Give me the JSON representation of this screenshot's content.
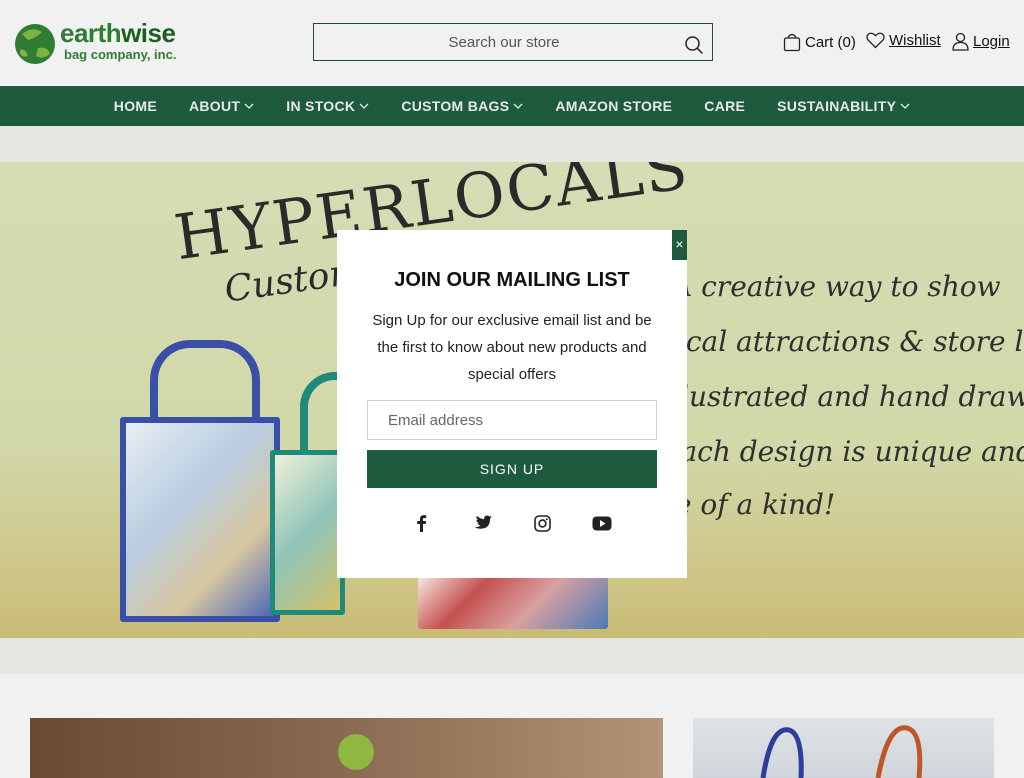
{
  "header": {
    "logo": {
      "main_a": "earth",
      "main_b": "wise",
      "sub": "bag company, inc."
    },
    "search": {
      "placeholder": "Search our store"
    },
    "cart": {
      "label": "Cart (",
      "count": "0",
      "close": ")"
    },
    "wishlist_label": " Wishlist",
    "login_label": " Login"
  },
  "nav": {
    "items": [
      {
        "label": "HOME",
        "has_dropdown": false
      },
      {
        "label": "ABOUT",
        "has_dropdown": true
      },
      {
        "label": "IN STOCK",
        "has_dropdown": true
      },
      {
        "label": "CUSTOM BAGS",
        "has_dropdown": true
      },
      {
        "label": "AMAZON STORE",
        "has_dropdown": false
      },
      {
        "label": "CARE",
        "has_dropdown": false
      },
      {
        "label": "SUSTAINABILITY",
        "has_dropdown": true
      }
    ]
  },
  "hero": {
    "title": "HYPERLOCALS",
    "subtitle": "Customized",
    "lines": [
      "A creative way to show",
      "local attractions & store locations.",
      "Illustrated and hand drawn",
      "Each design is unique and",
      "one of a kind!"
    ]
  },
  "modal": {
    "close_label": "×",
    "title": "JOIN OUR MAILING LIST",
    "text": "Sign Up for our exclusive email list and be the first to know about new products and special offers",
    "email_placeholder": "Email address",
    "button_label": "SIGN UP",
    "social": [
      "facebook-icon",
      "twitter-icon",
      "instagram-icon",
      "youtube-icon"
    ]
  },
  "colors": {
    "brand_green": "#1e5a3e",
    "logo_green": "#2e7d32",
    "page_bg": "#f1f1f1"
  }
}
